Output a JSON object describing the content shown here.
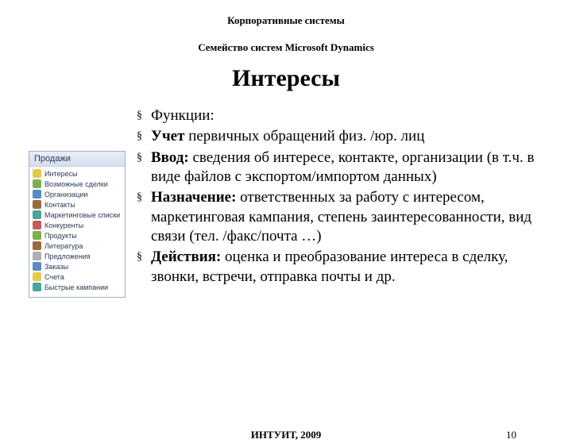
{
  "header_small": "Корпоративные системы",
  "subheader": "Семейство систем Microsoft Dynamics",
  "title": "Интересы",
  "sidebar": {
    "header": "Продажи",
    "items": [
      {
        "label": "Интересы",
        "icon": "ic-yellow",
        "name": "interests"
      },
      {
        "label": "Возможные сделки",
        "icon": "ic-green",
        "name": "opportunities"
      },
      {
        "label": "Организации",
        "icon": "ic-blue",
        "name": "organizations"
      },
      {
        "label": "Контакты",
        "icon": "ic-brown",
        "name": "contacts"
      },
      {
        "label": "Маркетинговые списки",
        "icon": "ic-teal",
        "name": "marketing-lists"
      },
      {
        "label": "Конкуренты",
        "icon": "ic-red",
        "name": "competitors"
      },
      {
        "label": "Продукты",
        "icon": "ic-green",
        "name": "products"
      },
      {
        "label": "Литература",
        "icon": "ic-brown",
        "name": "literature"
      },
      {
        "label": "Предложения",
        "icon": "ic-gray",
        "name": "offers"
      },
      {
        "label": "Заказы",
        "icon": "ic-blue",
        "name": "orders"
      },
      {
        "label": "Счета",
        "icon": "ic-yellow",
        "name": "invoices"
      },
      {
        "label": "Быстрые кампании",
        "icon": "ic-teal",
        "name": "quick-campaigns"
      }
    ]
  },
  "bullets": {
    "b1": "Функции:",
    "b2_label": "Учет",
    "b2_rest": " первичных обращений физ. /юр. лиц",
    "b3_label": "Ввод:",
    "b3_rest": " сведения об интересе, контакте, организации  (в т.ч. в виде файлов с экспортом/импортом данных)",
    "b4_label": "Назначение:",
    "b4_rest": " ответственных за работу с интересом, маркетинговая кампания, степень заинтересованности, вид связи (тел. /факс/почта …)",
    "b5_label": "Действия:",
    "b5_rest": " оценка и преобразование интереса в сделку, звонки, встречи, отправка почты и др."
  },
  "footer": {
    "center": "ИНТУИТ, 2009",
    "page": "10"
  }
}
